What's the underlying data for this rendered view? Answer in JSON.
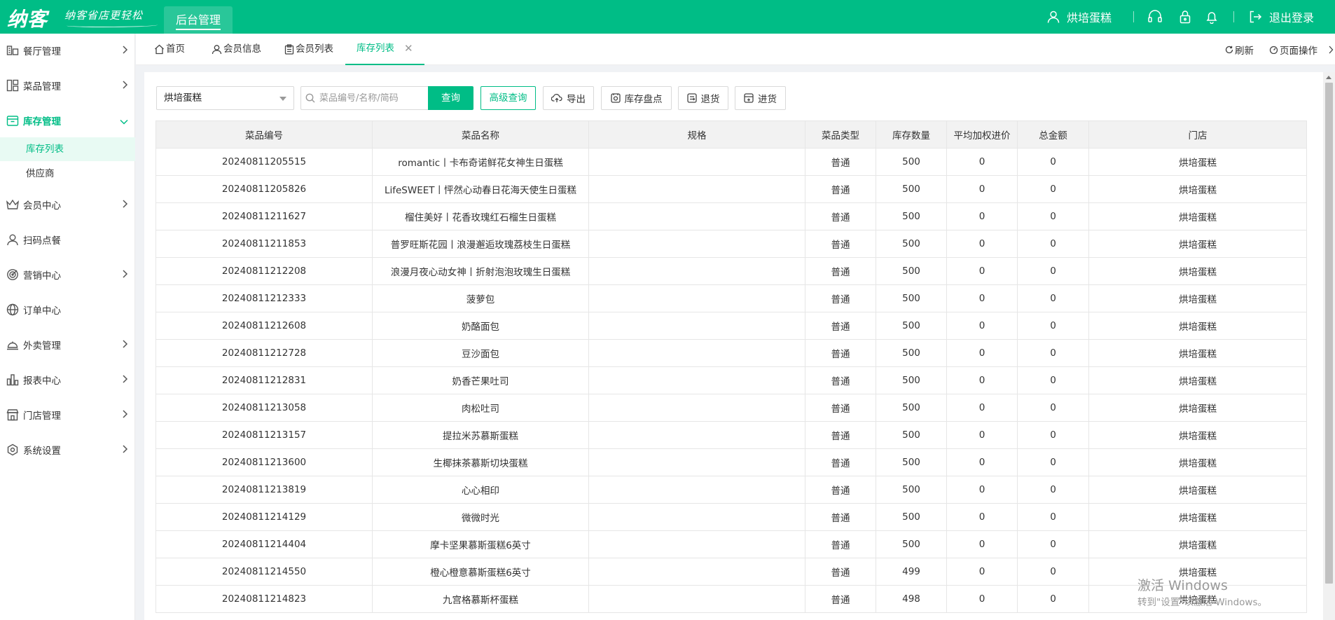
{
  "header": {
    "logo": "纳客",
    "slogan": "纳客省店更轻松",
    "nav_tab": "后台管理",
    "user_name": "烘培蛋糕",
    "logout": "退出登录"
  },
  "sidebar": {
    "items": [
      {
        "label": "餐厅管理",
        "icon": "store-icon",
        "has_chevron": true
      },
      {
        "label": "菜品管理",
        "icon": "grid-icon",
        "has_chevron": true
      },
      {
        "label": "库存管理",
        "icon": "box-icon",
        "has_chevron": true,
        "active": true
      },
      {
        "label": "会员中心",
        "icon": "crown-icon",
        "has_chevron": true
      },
      {
        "label": "扫码点餐",
        "icon": "user-icon",
        "has_chevron": false
      },
      {
        "label": "营销中心",
        "icon": "target-icon",
        "has_chevron": true
      },
      {
        "label": "订单中心",
        "icon": "globe-icon",
        "has_chevron": false
      },
      {
        "label": "外卖管理",
        "icon": "cloche-icon",
        "has_chevron": true
      },
      {
        "label": "报表中心",
        "icon": "bar-chart-icon",
        "has_chevron": true
      },
      {
        "label": "门店管理",
        "icon": "shop-icon",
        "has_chevron": true
      },
      {
        "label": "系统设置",
        "icon": "gear-icon",
        "has_chevron": true
      }
    ],
    "sub_items": [
      {
        "label": "库存列表",
        "active": true
      },
      {
        "label": "供应商",
        "active": false
      }
    ]
  },
  "tabs": [
    {
      "label": "首页",
      "icon": "home-icon"
    },
    {
      "label": "会员信息",
      "icon": "user-icon"
    },
    {
      "label": "会员列表",
      "icon": "clipboard-icon"
    },
    {
      "label": "库存列表",
      "active": true,
      "closable": true
    }
  ],
  "tab_tools": {
    "refresh": "刷新",
    "page_ops": "页面操作"
  },
  "toolbar": {
    "store_select": "烘培蛋糕",
    "search_placeholder": "菜品编号/名称/简码",
    "query": "查询",
    "advanced_query": "高级查询",
    "export": "导出",
    "stocktake": "库存盘点",
    "return": "退货",
    "purchase": "进货"
  },
  "table": {
    "columns": [
      "菜品编号",
      "菜品名称",
      "规格",
      "菜品类型",
      "库存数量",
      "平均加权进价",
      "总金额",
      "门店"
    ],
    "rows": [
      [
        "20240811205515",
        "romantic丨卡布奇诺鲜花女神生日蛋糕",
        "",
        "普通",
        "500",
        "0",
        "0",
        "烘培蛋糕"
      ],
      [
        "20240811205826",
        "LifeSWEET丨怦然心动春日花海天使生日蛋糕",
        "",
        "普通",
        "500",
        "0",
        "0",
        "烘培蛋糕"
      ],
      [
        "20240811211627",
        "榴住美好丨花香玫瑰红石榴生日蛋糕",
        "",
        "普通",
        "500",
        "0",
        "0",
        "烘培蛋糕"
      ],
      [
        "20240811211853",
        "普罗旺斯花园丨浪漫邂逅玫瑰荔枝生日蛋糕",
        "",
        "普通",
        "500",
        "0",
        "0",
        "烘培蛋糕"
      ],
      [
        "20240811212208",
        "浪漫月夜心动女神丨折射泡泡玫瑰生日蛋糕",
        "",
        "普通",
        "500",
        "0",
        "0",
        "烘培蛋糕"
      ],
      [
        "20240811212333",
        "菠萝包",
        "",
        "普通",
        "500",
        "0",
        "0",
        "烘培蛋糕"
      ],
      [
        "20240811212608",
        "奶酪面包",
        "",
        "普通",
        "500",
        "0",
        "0",
        "烘培蛋糕"
      ],
      [
        "20240811212728",
        "豆沙面包",
        "",
        "普通",
        "500",
        "0",
        "0",
        "烘培蛋糕"
      ],
      [
        "20240811212831",
        "奶香芒果吐司",
        "",
        "普通",
        "500",
        "0",
        "0",
        "烘培蛋糕"
      ],
      [
        "20240811213058",
        "肉松吐司",
        "",
        "普通",
        "500",
        "0",
        "0",
        "烘培蛋糕"
      ],
      [
        "20240811213157",
        "提拉米苏慕斯蛋糕",
        "",
        "普通",
        "500",
        "0",
        "0",
        "烘培蛋糕"
      ],
      [
        "20240811213600",
        "生椰抹茶慕斯切块蛋糕",
        "",
        "普通",
        "500",
        "0",
        "0",
        "烘培蛋糕"
      ],
      [
        "20240811213819",
        "心心相印",
        "",
        "普通",
        "500",
        "0",
        "0",
        "烘培蛋糕"
      ],
      [
        "20240811214129",
        "微微时光",
        "",
        "普通",
        "500",
        "0",
        "0",
        "烘培蛋糕"
      ],
      [
        "20240811214404",
        "摩卡坚果慕斯蛋糕6英寸",
        "",
        "普通",
        "500",
        "0",
        "0",
        "烘培蛋糕"
      ],
      [
        "20240811214550",
        "橙心橙意慕斯蛋糕6英寸",
        "",
        "普通",
        "499",
        "0",
        "0",
        "烘培蛋糕"
      ],
      [
        "20240811214823",
        "九宫格慕斯杯蛋糕",
        "",
        "普通",
        "498",
        "0",
        "0",
        "烘培蛋糕"
      ]
    ]
  },
  "watermark": {
    "line1": "激活 Windows",
    "line2": "转到\"设置\"以激活 Windows。"
  },
  "colors": {
    "brand": "#00bd86",
    "active_sub_bg": "#e8faf3"
  }
}
